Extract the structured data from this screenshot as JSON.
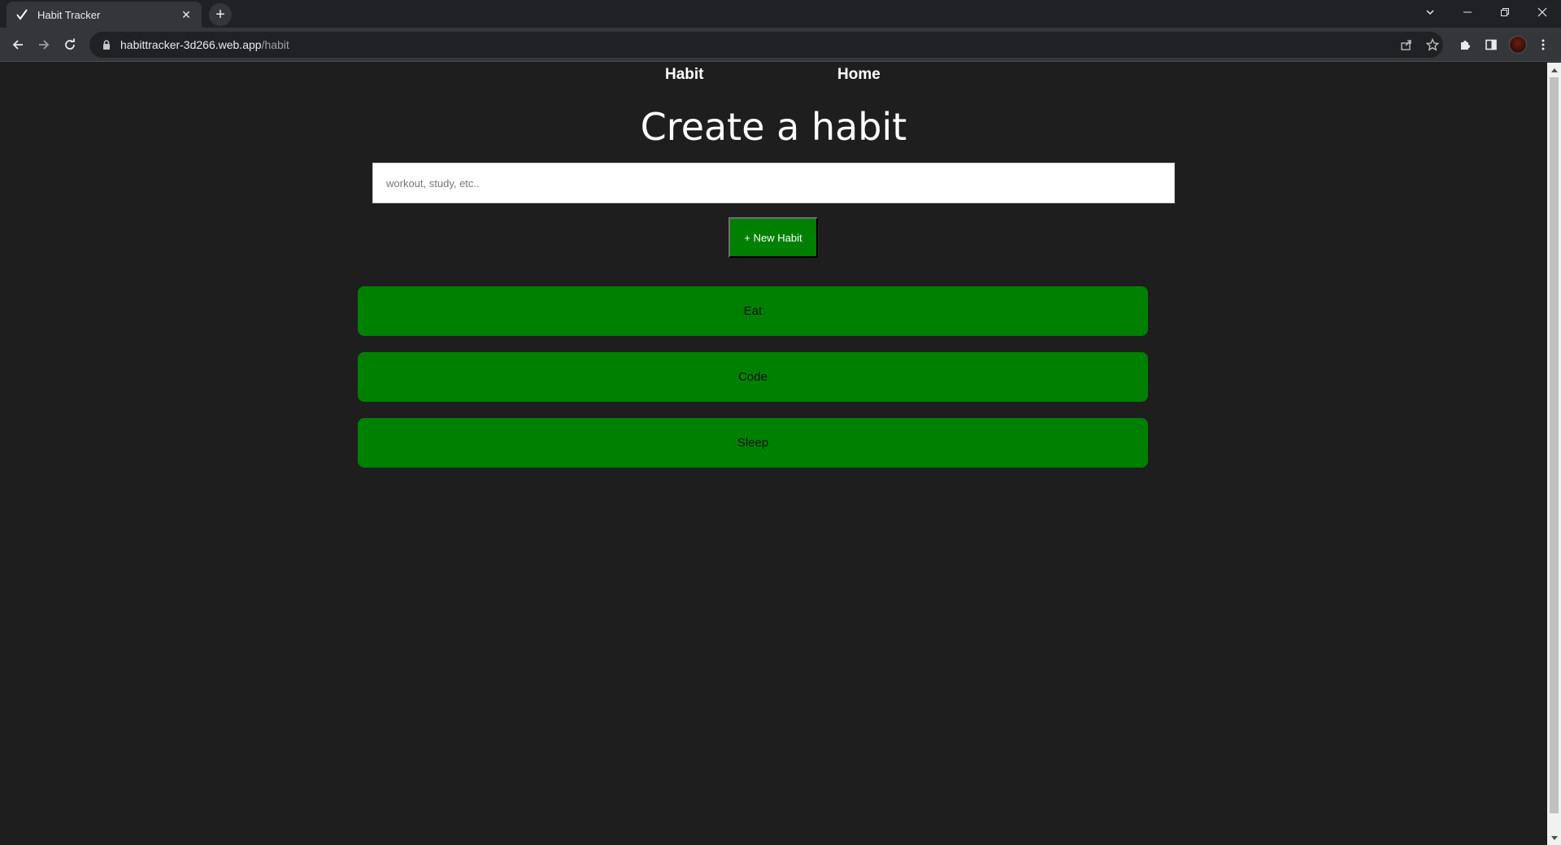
{
  "browser": {
    "tab_title": "Habit Tracker",
    "tab_close": "✕",
    "newtab": "+",
    "url_host": "habittracker-3d266.web.app",
    "url_path": "/habit",
    "icons": [
      "back-icon",
      "forward-icon",
      "reload-icon",
      "lock-icon",
      "share-icon",
      "star-icon",
      "extensions-icon",
      "sidepanel-icon",
      "menu-icon"
    ]
  },
  "nav": {
    "habit_label": "Habit",
    "home_label": "Home"
  },
  "main": {
    "heading": "Create a habit",
    "input_placeholder": "workout, study, etc..",
    "input_value": "",
    "new_habit_label": "+ New Habit"
  },
  "habits": [
    "Eat",
    "Code",
    "Sleep"
  ],
  "colors": {
    "background": "#1e1e1e",
    "accent_green": "#008000"
  }
}
